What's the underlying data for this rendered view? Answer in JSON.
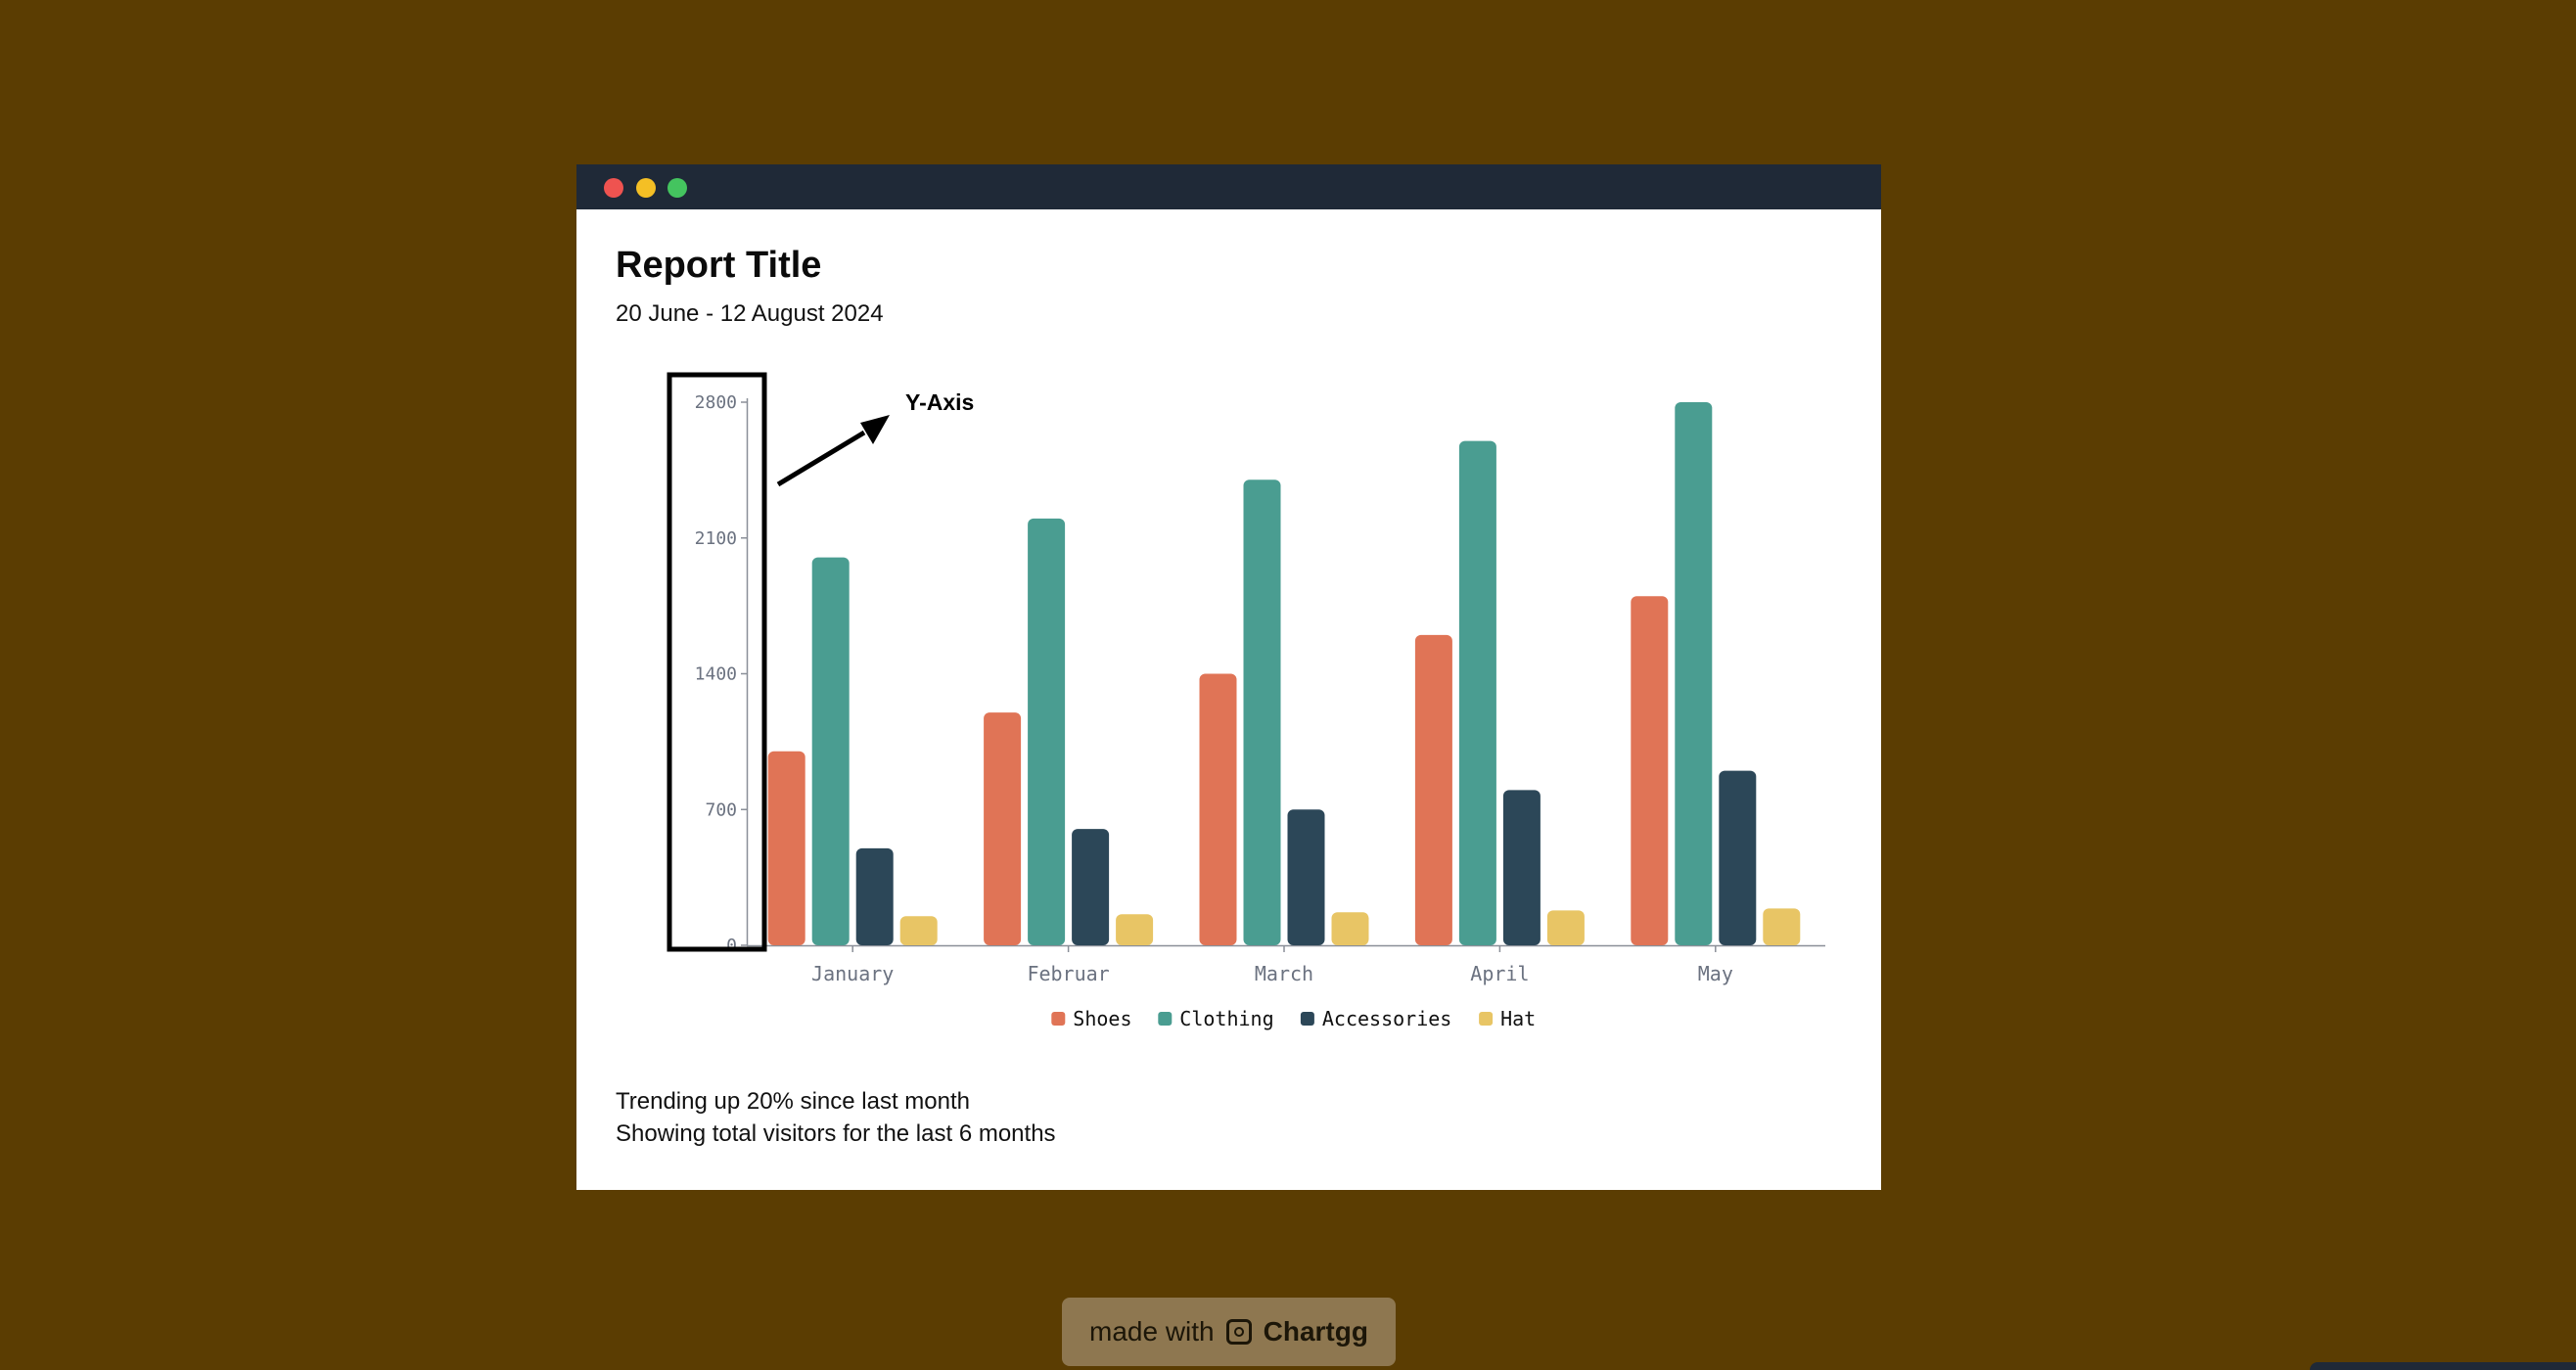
{
  "window": {
    "controls": [
      "close",
      "minimize",
      "maximize"
    ]
  },
  "report": {
    "title": "Report Title",
    "subtitle": "20 June - 12 August 2024",
    "footer_line1": "Trending up 20% since last month",
    "footer_line2": "Showing total visitors for the last 6 months"
  },
  "annotation": {
    "label": "Y-Axis"
  },
  "chart_data": {
    "type": "bar",
    "categories": [
      "January",
      "Februar",
      "March",
      "April",
      "May"
    ],
    "series": [
      {
        "name": "Shoes",
        "color": "#e07456",
        "values": [
          1000,
          1200,
          1400,
          1600,
          1800
        ]
      },
      {
        "name": "Clothing",
        "color": "#4a9d91",
        "values": [
          2000,
          2200,
          2400,
          2600,
          2800
        ]
      },
      {
        "name": "Accessories",
        "color": "#2c4758",
        "values": [
          500,
          600,
          700,
          800,
          900
        ]
      },
      {
        "name": "Hat",
        "color": "#e8c565",
        "values": [
          150,
          160,
          170,
          180,
          190
        ]
      }
    ],
    "yticks": [
      0,
      700,
      1400,
      2100,
      2800
    ],
    "ylim": [
      0,
      2800
    ],
    "legend_position": "bottom",
    "grid": false
  },
  "badge": {
    "prefix": "made with",
    "brand": "Chartgg"
  }
}
